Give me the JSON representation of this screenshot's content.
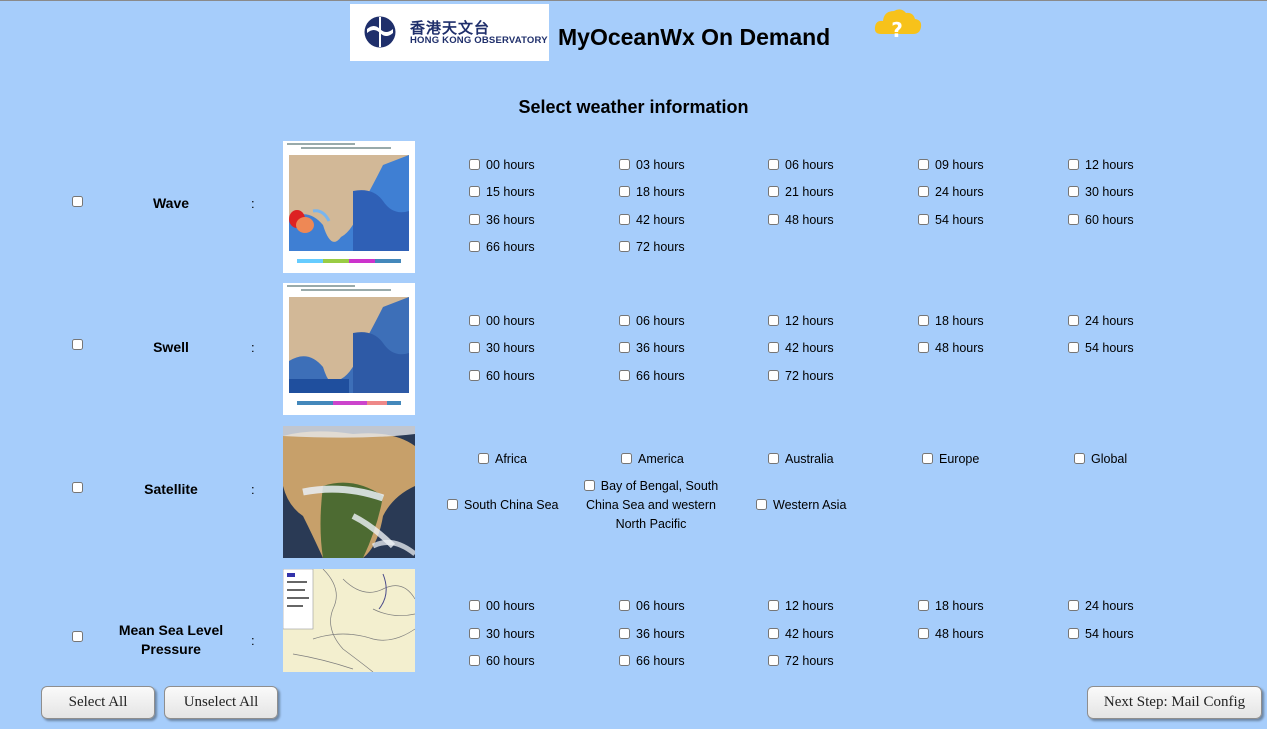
{
  "header": {
    "logo_cn": "香港天文台",
    "logo_en": "HONG KONG OBSERVATORY",
    "title": "MyOceanWx On Demand"
  },
  "page_heading": "Select weather information",
  "rows": [
    {
      "label": "Wave",
      "options": [
        "00 hours",
        "03 hours",
        "06 hours",
        "09 hours",
        "12 hours",
        "15 hours",
        "18 hours",
        "21 hours",
        "24 hours",
        "30 hours",
        "36 hours",
        "42 hours",
        "48 hours",
        "54 hours",
        "60 hours",
        "66 hours",
        "72 hours"
      ]
    },
    {
      "label": "Swell",
      "options": [
        "00 hours",
        "06 hours",
        "12 hours",
        "18 hours",
        "24 hours",
        "30 hours",
        "36 hours",
        "42 hours",
        "48 hours",
        "54 hours",
        "60 hours",
        "66 hours",
        "72 hours"
      ]
    },
    {
      "label": "Satellite",
      "options": [
        "Africa",
        "America",
        "Australia",
        "Europe",
        "Global",
        "South China Sea",
        "Bay of Bengal, South China Sea and western North Pacific",
        "Western Asia"
      ]
    },
    {
      "label": "Mean Sea Level Pressure",
      "options": [
        "00 hours",
        "06 hours",
        "12 hours",
        "18 hours",
        "24 hours",
        "30 hours",
        "36 hours",
        "42 hours",
        "48 hours",
        "54 hours",
        "60 hours",
        "66 hours",
        "72 hours"
      ]
    }
  ],
  "buttons": {
    "select_all": "Select All",
    "unselect_all": "Unselect All",
    "next": "Next Step: Mail Config"
  },
  "colors": {
    "background": "#a6cdfb",
    "help_icon": "#f7c21a",
    "logo_text": "#1f2f6b"
  }
}
